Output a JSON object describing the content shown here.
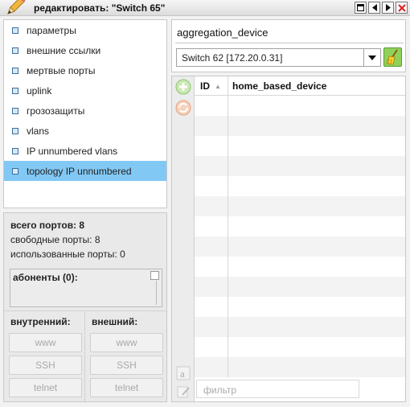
{
  "window": {
    "title": "редактировать: \"Switch 65\"",
    "icons": [
      "pencil-icon",
      "maximize-icon",
      "prev-icon",
      "next-icon",
      "close-icon"
    ]
  },
  "menu": {
    "items": [
      {
        "label": "параметры"
      },
      {
        "label": "внешние ссылки"
      },
      {
        "label": "мертвые порты"
      },
      {
        "label": "uplink"
      },
      {
        "label": "грозозащиты"
      },
      {
        "label": "vlans"
      },
      {
        "label": "IP unnumbered vlans"
      },
      {
        "label": "topology IP unnumbered",
        "selected": true
      }
    ]
  },
  "ports": {
    "total": "всего портов: 8",
    "free": "свободные порты: 8",
    "used": "использованные порты: 0",
    "subscribers": "абоненты (0):",
    "internal_label": "внутренний:",
    "external_label": "внешний:",
    "internal_buttons": [
      "www",
      "SSH",
      "telnet"
    ],
    "external_buttons": [
      "www",
      "SSH",
      "telnet"
    ]
  },
  "aggregation": {
    "title": "aggregation_device",
    "selected": "Switch 62 [172.20.0.31]"
  },
  "table": {
    "columns": [
      "ID",
      "home_based_device"
    ],
    "rows": [],
    "filter_placeholder": "фильтр"
  },
  "colors": {
    "selection": "#82c8f4",
    "add_button": "#7fcf5a",
    "refresh_button": "#f0a070",
    "broom_bg": "#8fd25a"
  }
}
